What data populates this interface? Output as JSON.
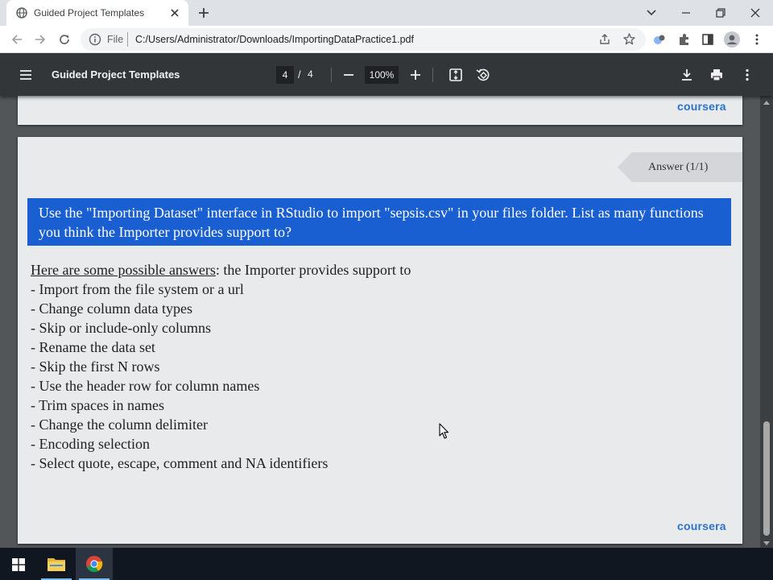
{
  "browser": {
    "tab_title": "Guided Project Templates",
    "omnibox": {
      "scheme": "File",
      "url": "C:/Users/Administrator/Downloads/ImportingDataPractice1.pdf"
    }
  },
  "pdf_toolbar": {
    "title": "Guided Project Templates",
    "current_page": "4",
    "page_separator": "/",
    "total_pages": "4",
    "zoom": "100%"
  },
  "pdf_page": {
    "logo_text": "coursera",
    "answer_tab_label": "Answer (1/1)",
    "question": "Use the \"Importing Dataset\" interface in RStudio to import \"sepsis.csv\" in your files folder. List as many functions you think the Importer provides support to?",
    "intro_underlined": "Here are some possible answers",
    "intro_rest": ": the Importer provides support to",
    "answers": [
      "- Import from the file system or a url",
      "- Change column data types",
      "- Skip or include-only columns",
      "- Rename the data set",
      "- Skip the first N rows",
      "- Use the header row for column names",
      "- Trim spaces in names",
      "- Change the column delimiter",
      "- Encoding selection",
      "- Select quote, escape, comment and NA identifiers"
    ]
  },
  "colors": {
    "question_bg": "#1a5fd1",
    "coursera_blue": "#2a73cc",
    "pdf_toolbar_bg": "#323639",
    "page_bg": "#e9eaec"
  },
  "icons": {
    "tab_favicon": "globe-icon",
    "tab_close": "close-icon",
    "new_tab": "plus-icon",
    "back": "arrow-left-icon",
    "forward": "arrow-right-icon",
    "reload": "reload-icon",
    "info": "info-icon",
    "share": "share-icon",
    "bookmark": "star-icon",
    "extensions": "puzzle-icon",
    "side_panel": "side-panel-icon",
    "profile": "profile-icon",
    "menu": "kebab-menu-icon",
    "pdf_sidebar": "hamburger-icon",
    "zoom_out": "minus-icon",
    "zoom_in": "plus-icon",
    "fit_page": "fit-page-icon",
    "rotate": "rotate-icon",
    "download": "download-icon",
    "print": "print-icon",
    "pdf_more": "kebab-menu-icon"
  }
}
